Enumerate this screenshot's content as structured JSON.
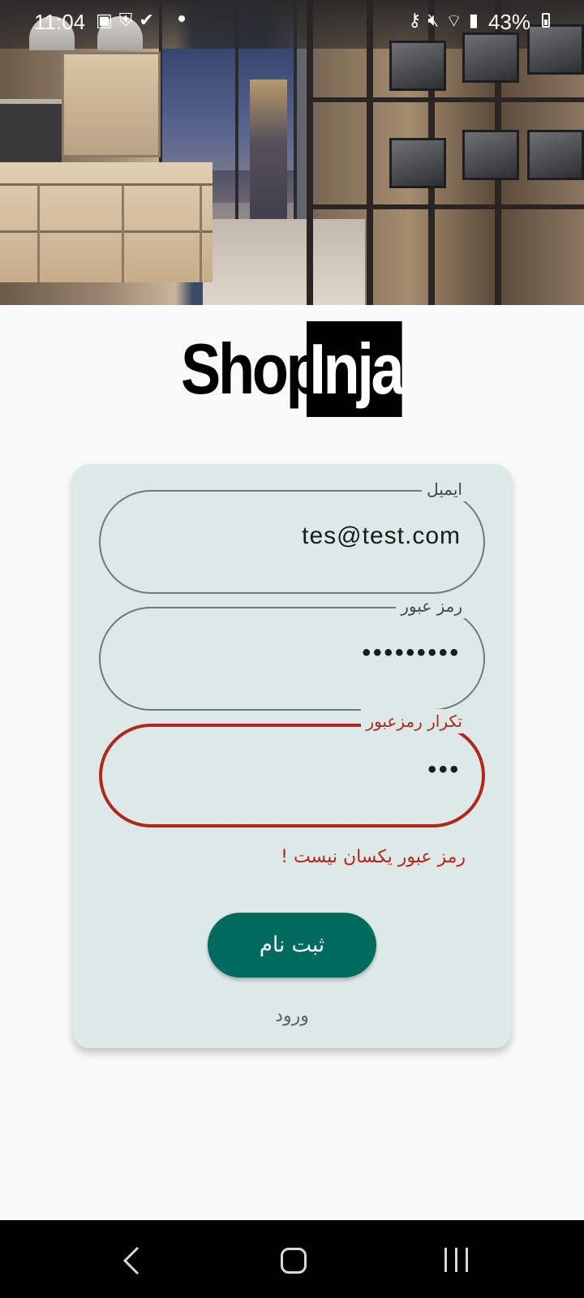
{
  "status_bar": {
    "time": "11:04",
    "battery": "43%"
  },
  "logo": {
    "part1": "Shop",
    "part2": "Inja"
  },
  "form": {
    "email": {
      "label": "ایمیل",
      "value": "tes@test.com"
    },
    "password": {
      "label": "رمز عبور",
      "value": "•••••••••"
    },
    "confirm_password": {
      "label": "تکرار رمزعبور",
      "value": "•••",
      "error": true
    },
    "error_message": "رمز عبور یکسان نیست !",
    "submit_label": "ثبت نام",
    "login_link": "ورود"
  },
  "colors": {
    "accent": "#006b5e",
    "error": "#b3261e",
    "card": "#dce9e7"
  }
}
